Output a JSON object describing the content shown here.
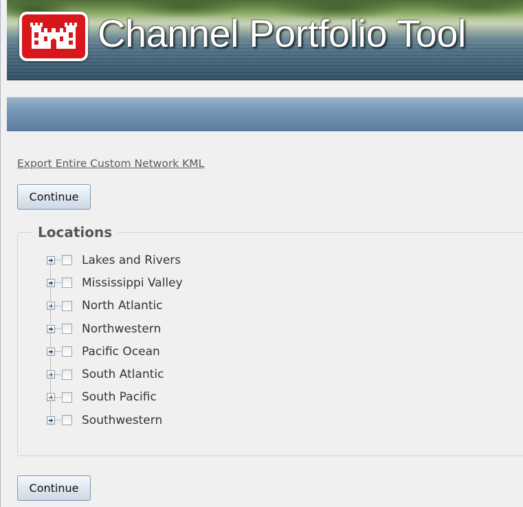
{
  "header": {
    "title": "Channel Portfolio Tool",
    "logo_icon": "usace-castle-logo-icon",
    "logo_color": "#d8171d"
  },
  "nav_bar": {
    "color": "#7796b6"
  },
  "export_link": {
    "label": "Export Entire Custom Network KML"
  },
  "buttons": {
    "continue_top": "Continue",
    "continue_bottom": "Continue"
  },
  "locations": {
    "legend": "Locations",
    "items": [
      {
        "label": "Lakes and Rivers",
        "checked": false,
        "expanded": false
      },
      {
        "label": "Mississippi Valley",
        "checked": false,
        "expanded": false
      },
      {
        "label": "North Atlantic",
        "checked": false,
        "expanded": false
      },
      {
        "label": "Northwestern",
        "checked": false,
        "expanded": false
      },
      {
        "label": "Pacific Ocean",
        "checked": false,
        "expanded": false
      },
      {
        "label": "South Atlantic",
        "checked": false,
        "expanded": false
      },
      {
        "label": "South Pacific",
        "checked": false,
        "expanded": false
      },
      {
        "label": "Southwestern",
        "checked": false,
        "expanded": false
      }
    ]
  }
}
